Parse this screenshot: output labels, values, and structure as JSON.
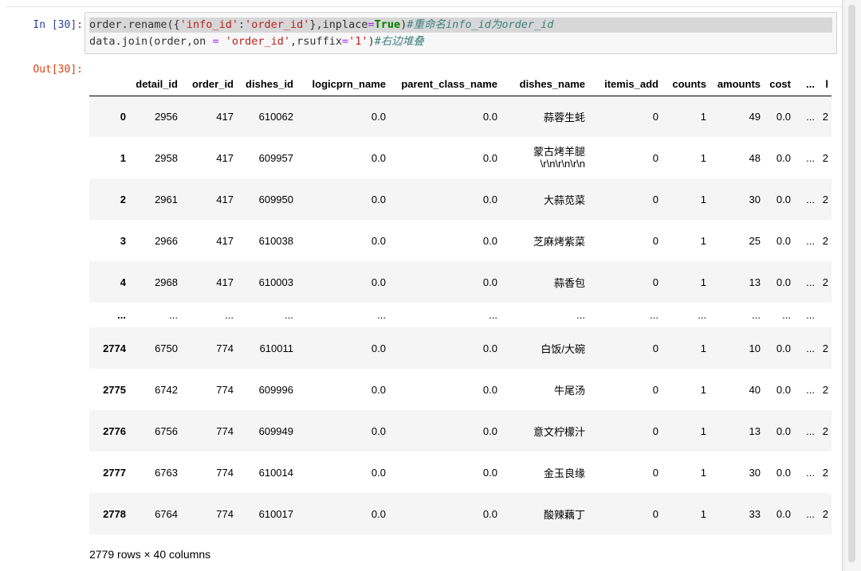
{
  "input_prompt": "In  [30]:",
  "output_prompt": "Out[30]:",
  "code": {
    "line1": {
      "t1": "order.rename({",
      "t2": "'info_id'",
      "t3": ":",
      "t4": "'order_id'",
      "t5": "},inplace",
      "t6": "=",
      "t7": "True",
      "t8": ")",
      "t9": "#重命名info_id为order_id"
    },
    "line2": {
      "t1": "data.join(order,on ",
      "t2": "=",
      "t3": " ",
      "t4": "'order_id'",
      "t5": ",rsuffix",
      "t6": "=",
      "t7": "'1'",
      "t8": ")",
      "t9": "#右边堆叠"
    }
  },
  "dataframe": {
    "columns": [
      "",
      "detail_id",
      "order_id",
      "dishes_id",
      "logicprn_name",
      "parent_class_name",
      "dishes_name",
      "itemis_add",
      "counts",
      "amounts",
      "cost",
      "...",
      "l"
    ],
    "rows": [
      [
        "0",
        "2956",
        "417",
        "610062",
        "0.0",
        "0.0",
        "蒜蓉生蚝",
        "0",
        "1",
        "49",
        "0.0",
        "...",
        "2"
      ],
      [
        "1",
        "2958",
        "417",
        "609957",
        "0.0",
        "0.0",
        "蒙古烤羊腿\\r\\n\\r\\n\\r\\n",
        "0",
        "1",
        "48",
        "0.0",
        "...",
        "2"
      ],
      [
        "2",
        "2961",
        "417",
        "609950",
        "0.0",
        "0.0",
        "大蒜苋菜",
        "0",
        "1",
        "30",
        "0.0",
        "...",
        "2"
      ],
      [
        "3",
        "2966",
        "417",
        "610038",
        "0.0",
        "0.0",
        "芝麻烤紫菜",
        "0",
        "1",
        "25",
        "0.0",
        "...",
        "2"
      ],
      [
        "4",
        "2968",
        "417",
        "610003",
        "0.0",
        "0.0",
        "蒜香包",
        "0",
        "1",
        "13",
        "0.0",
        "...",
        "2"
      ],
      [
        "...",
        "...",
        "...",
        "...",
        "...",
        "...",
        "...",
        "...",
        "...",
        "...",
        "...",
        "...",
        ""
      ],
      [
        "2774",
        "6750",
        "774",
        "610011",
        "0.0",
        "0.0",
        "白饭/大碗",
        "0",
        "1",
        "10",
        "0.0",
        "...",
        "2"
      ],
      [
        "2775",
        "6742",
        "774",
        "609996",
        "0.0",
        "0.0",
        "牛尾汤",
        "0",
        "1",
        "40",
        "0.0",
        "...",
        "2"
      ],
      [
        "2776",
        "6756",
        "774",
        "609949",
        "0.0",
        "0.0",
        "意文柠檬汁",
        "0",
        "1",
        "13",
        "0.0",
        "...",
        "2"
      ],
      [
        "2777",
        "6763",
        "774",
        "610014",
        "0.0",
        "0.0",
        "金玉良缘",
        "0",
        "1",
        "30",
        "0.0",
        "...",
        "2"
      ],
      [
        "2778",
        "6764",
        "774",
        "610017",
        "0.0",
        "0.0",
        "酸辣藕丁",
        "0",
        "1",
        "33",
        "0.0",
        "...",
        "2"
      ]
    ]
  },
  "dish_multiline": {
    "first": "蒙古烤羊腿",
    "second": "\\r\\n\\r\\n\\r\\n"
  },
  "row_count": "2779 rows × 40 columns",
  "colors": {
    "in_prompt": "#303f9f",
    "out_prompt": "#d84315",
    "string": "#ba2121",
    "keyword": "#008000",
    "comment": "#408080",
    "operator": "#aa22ff"
  }
}
